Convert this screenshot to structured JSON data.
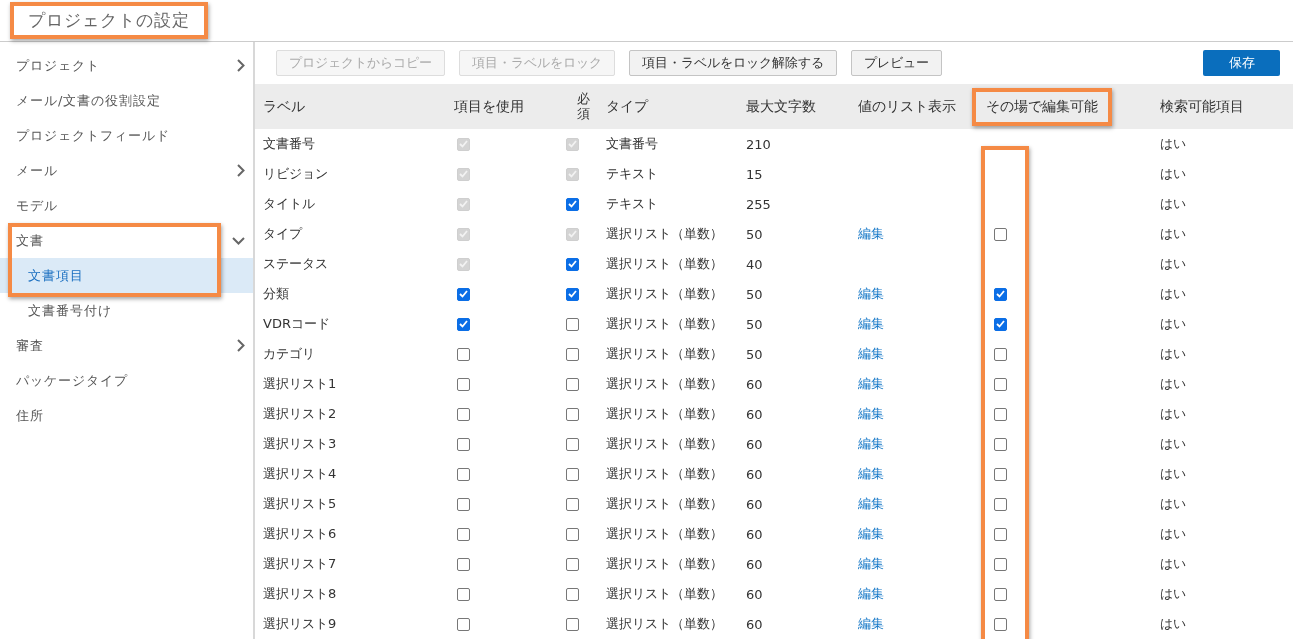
{
  "window": {
    "title": "プロジェクトの設定",
    "title_highlighted": true
  },
  "sidebar": {
    "items": [
      {
        "label": "プロジェクト",
        "expandable": true,
        "expanded": false,
        "selected": false
      },
      {
        "label": "メール/文書の役割設定",
        "selected": false
      },
      {
        "label": "プロジェクトフィールド",
        "selected": false
      },
      {
        "label": "メール",
        "expandable": true,
        "expanded": false,
        "selected": false
      },
      {
        "label": "モデル",
        "selected": false
      },
      {
        "label": "文書",
        "expandable": true,
        "expanded": true,
        "selected": false,
        "highlighted": true,
        "children": [
          {
            "label": "文書項目",
            "selected": true
          },
          {
            "label": "文書番号付け",
            "selected": false
          }
        ]
      },
      {
        "label": "審査",
        "expandable": true,
        "expanded": false,
        "selected": false
      },
      {
        "label": "パッケージタイプ",
        "selected": false
      },
      {
        "label": "住所",
        "selected": false
      }
    ]
  },
  "toolbar": {
    "buttons": [
      {
        "label": "プロジェクトからコピー",
        "disabled": true
      },
      {
        "label": "項目・ラベルをロック",
        "disabled": true
      },
      {
        "label": "項目・ラベルをロック解除する",
        "disabled": false
      },
      {
        "label": "プレビュー",
        "disabled": false
      }
    ],
    "save": {
      "label": "保存"
    }
  },
  "table": {
    "columns": [
      {
        "label": "ラベル",
        "highlighted": false
      },
      {
        "label": "項目を使用",
        "highlighted": false
      },
      {
        "label": "必須",
        "highlighted": false,
        "vertical": true
      },
      {
        "label": "タイプ",
        "highlighted": false
      },
      {
        "label": "最大文字数",
        "highlighted": false
      },
      {
        "label": "値のリスト表示",
        "highlighted": false
      },
      {
        "label": "その場で編集可能",
        "highlighted": true
      },
      {
        "label": "検索可能項目",
        "highlighted": false
      }
    ],
    "rows": [
      {
        "label": "文書番号",
        "use": {
          "checked": true,
          "disabled": true
        },
        "required": {
          "checked": true,
          "disabled": true
        },
        "type": "文書番号",
        "max": "210",
        "searchable": "はい"
      },
      {
        "label": "リビジョン",
        "use": {
          "checked": true,
          "disabled": true
        },
        "required": {
          "checked": true,
          "disabled": true
        },
        "type": "テキスト",
        "max": "15",
        "searchable": "はい"
      },
      {
        "label": "タイトル",
        "use": {
          "checked": true,
          "disabled": true
        },
        "required": {
          "checked": true,
          "disabled": false
        },
        "type": "テキスト",
        "max": "255",
        "searchable": "はい"
      },
      {
        "label": "タイプ",
        "use": {
          "checked": true,
          "disabled": true
        },
        "required": {
          "checked": true,
          "disabled": true
        },
        "type": "選択リスト（単数）",
        "max": "50",
        "list_link": "編集",
        "inplace": {
          "checked": false,
          "disabled": false
        },
        "searchable": "はい"
      },
      {
        "label": "ステータス",
        "use": {
          "checked": true,
          "disabled": true
        },
        "required": {
          "checked": true,
          "disabled": false
        },
        "type": "選択リスト（単数）",
        "max": "40",
        "searchable": "はい"
      },
      {
        "label": "分類",
        "use": {
          "checked": true,
          "disabled": false
        },
        "required": {
          "checked": true,
          "disabled": false
        },
        "type": "選択リスト（単数）",
        "max": "50",
        "list_link": "編集",
        "inplace": {
          "checked": true,
          "disabled": false
        },
        "searchable": "はい"
      },
      {
        "label": "VDRコード",
        "use": {
          "checked": true,
          "disabled": false
        },
        "required": {
          "checked": false,
          "disabled": false
        },
        "type": "選択リスト（単数）",
        "max": "50",
        "list_link": "編集",
        "inplace": {
          "checked": true,
          "disabled": false
        },
        "searchable": "はい"
      },
      {
        "label": "カテゴリ",
        "use": {
          "checked": false,
          "disabled": false
        },
        "required": {
          "checked": false,
          "disabled": false
        },
        "type": "選択リスト（単数）",
        "max": "50",
        "list_link": "編集",
        "inplace": {
          "checked": false,
          "disabled": false
        },
        "searchable": "はい"
      },
      {
        "label": "選択リスト1",
        "use": {
          "checked": false,
          "disabled": false
        },
        "required": {
          "checked": false,
          "disabled": false
        },
        "type": "選択リスト（単数）",
        "max": "60",
        "list_link": "編集",
        "inplace": {
          "checked": false,
          "disabled": false
        },
        "searchable": "はい"
      },
      {
        "label": "選択リスト2",
        "use": {
          "checked": false,
          "disabled": false
        },
        "required": {
          "checked": false,
          "disabled": false
        },
        "type": "選択リスト（単数）",
        "max": "60",
        "list_link": "編集",
        "inplace": {
          "checked": false,
          "disabled": false
        },
        "searchable": "はい"
      },
      {
        "label": "選択リスト3",
        "use": {
          "checked": false,
          "disabled": false
        },
        "required": {
          "checked": false,
          "disabled": false
        },
        "type": "選択リスト（単数）",
        "max": "60",
        "list_link": "編集",
        "inplace": {
          "checked": false,
          "disabled": false
        },
        "searchable": "はい"
      },
      {
        "label": "選択リスト4",
        "use": {
          "checked": false,
          "disabled": false
        },
        "required": {
          "checked": false,
          "disabled": false
        },
        "type": "選択リスト（単数）",
        "max": "60",
        "list_link": "編集",
        "inplace": {
          "checked": false,
          "disabled": false
        },
        "searchable": "はい"
      },
      {
        "label": "選択リスト5",
        "use": {
          "checked": false,
          "disabled": false
        },
        "required": {
          "checked": false,
          "disabled": false
        },
        "type": "選択リスト（単数）",
        "max": "60",
        "list_link": "編集",
        "inplace": {
          "checked": false,
          "disabled": false
        },
        "searchable": "はい"
      },
      {
        "label": "選択リスト6",
        "use": {
          "checked": false,
          "disabled": false
        },
        "required": {
          "checked": false,
          "disabled": false
        },
        "type": "選択リスト（単数）",
        "max": "60",
        "list_link": "編集",
        "inplace": {
          "checked": false,
          "disabled": false
        },
        "searchable": "はい"
      },
      {
        "label": "選択リスト7",
        "use": {
          "checked": false,
          "disabled": false
        },
        "required": {
          "checked": false,
          "disabled": false
        },
        "type": "選択リスト（単数）",
        "max": "60",
        "list_link": "編集",
        "inplace": {
          "checked": false,
          "disabled": false
        },
        "searchable": "はい"
      },
      {
        "label": "選択リスト8",
        "use": {
          "checked": false,
          "disabled": false
        },
        "required": {
          "checked": false,
          "disabled": false
        },
        "type": "選択リスト（単数）",
        "max": "60",
        "list_link": "編集",
        "inplace": {
          "checked": false,
          "disabled": false
        },
        "searchable": "はい"
      },
      {
        "label": "選択リスト9",
        "use": {
          "checked": false,
          "disabled": false
        },
        "required": {
          "checked": false,
          "disabled": false
        },
        "type": "選択リスト（単数）",
        "max": "60",
        "list_link": "編集",
        "inplace": {
          "checked": false,
          "disabled": false
        },
        "searchable": "はい"
      }
    ]
  }
}
